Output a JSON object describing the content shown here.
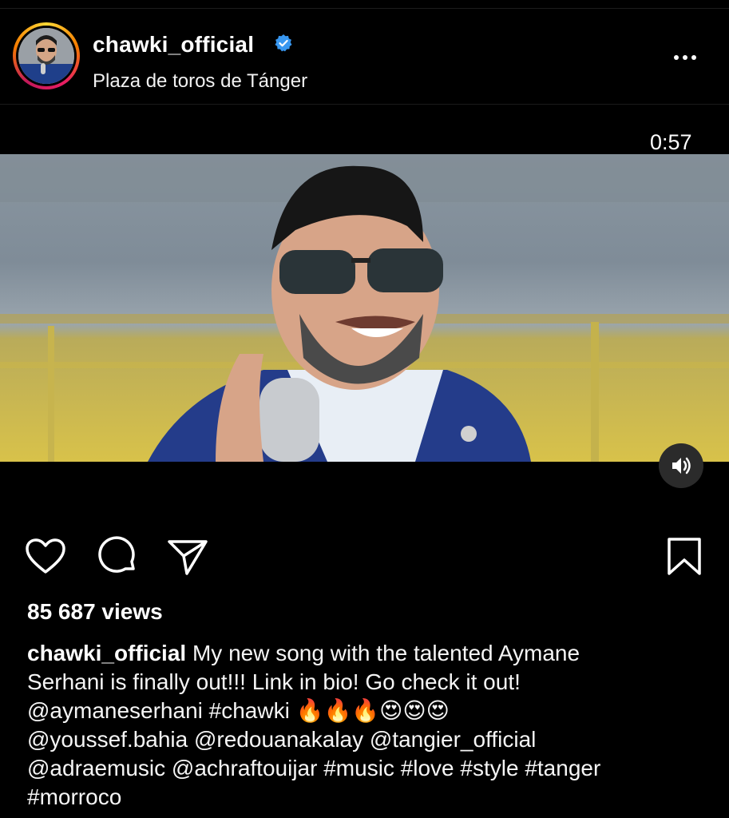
{
  "post": {
    "username": "chawki_official",
    "location": "Plaza de toros de Tánger",
    "verified": true,
    "video_duration": "0:57",
    "views": "85 687 views"
  },
  "caption": {
    "user": "chawki_official",
    "line1": "My new song with the talented Aymane",
    "line2": "Serhani is finally out!!! Link in bio! Go check it out!",
    "line3_text": "@aymaneserhani #chawki ",
    "line3_emoji": "🔥🔥🔥😍😍😍",
    "line4": "@youssef.bahia @redouanakalay @tangier_official",
    "line5": "@adraemusic @achraftouijar #music #love #style #tanger",
    "line6": "#morroco"
  },
  "icons": {
    "like": "heart-icon",
    "comment": "comment-icon",
    "share": "send-icon",
    "save": "bookmark-icon",
    "sound": "speaker-icon",
    "more": "more-dots-icon",
    "verified": "verified-badge-icon"
  },
  "colors": {
    "background": "#000000",
    "verified": "#3897f0"
  }
}
